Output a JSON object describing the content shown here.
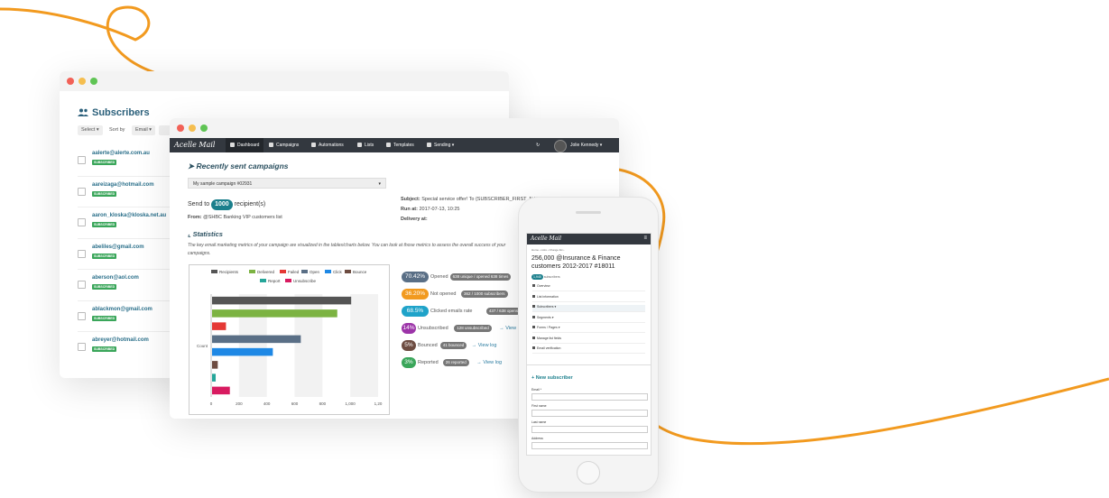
{
  "back_window": {
    "title": "Subscribers",
    "select_label": "Select",
    "sort_by_label": "Sort by",
    "sort_field": "Email",
    "subscribers": [
      {
        "email": "aalerte@alerte.com.au",
        "status": "SUBSCRIBED"
      },
      {
        "email": "aareizaga@hotmail.com",
        "status": "SUBSCRIBED"
      },
      {
        "email": "aaron_kloska@kloska.net.au",
        "status": "SUBSCRIBED"
      },
      {
        "email": "abeliles@gmail.com",
        "status": "SUBSCRIBED"
      },
      {
        "email": "aberson@aol.com",
        "status": "SUBSCRIBED"
      },
      {
        "email": "ablackmon@gmail.com",
        "status": "SUBSCRIBED"
      },
      {
        "email": "abreyer@hotmail.com",
        "status": "SUBSCRIBED"
      }
    ]
  },
  "main_window": {
    "nav": {
      "logo": "Acelle Mail",
      "items": [
        "Dashboard",
        "Campaigns",
        "Automations",
        "Lists",
        "Templates",
        "Sending"
      ],
      "user": "Jolie Kennedy"
    },
    "recent_heading": "Recently sent campaigns",
    "campaign_select": "My sample campaign #02931",
    "send_to_prefix": "Send to",
    "send_to_count": "1000",
    "send_to_suffix": "recipient(s)",
    "from_label": "From:",
    "from_value": "@SHBC Banking VIP customers list",
    "subject_label": "Subject:",
    "subject_value": "Special service offer! To {SUBSCRIBER_FIRST_NAME}",
    "run_at_label": "Run at:",
    "run_at_value": "2017-07-13, 10:25",
    "delivery_label": "Delivery at:",
    "statistics_heading": "Statistics",
    "statistics_desc": "The key email marketing metrics of your campaign are visualized in the tables/charts below. You can look at those metrics to assess the overall success of your",
    "statistics_desc2": "campaigns.",
    "stats": [
      {
        "pct": "70.42%",
        "label": "Opened",
        "pill": "638 unique / opened 638 times",
        "color": "#5a6f86",
        "log": ""
      },
      {
        "pct": "36.20%",
        "label": "Not opened",
        "pill": "362 / 1000 subscribers",
        "color": "#f29a1f",
        "log": "→"
      },
      {
        "pct": "68.5%",
        "label": "Clicked emails rate",
        "pill": "437 / 638 opens",
        "color": "#1fa3c9",
        "log": "→"
      },
      {
        "pct": "14%",
        "label": "Unsubscribed",
        "pill": "128 unsubscribed",
        "color": "#9c34a8",
        "log": "→ View l"
      },
      {
        "pct": "5%",
        "label": "Bounced",
        "pill": "41 bounced",
        "color": "#6d4c41",
        "log": "→ View log"
      },
      {
        "pct": "3%",
        "label": "Reported",
        "pill": "26 reported",
        "color": "#3aa65a",
        "log": "→ View log"
      }
    ]
  },
  "chart_data": {
    "type": "bar",
    "orientation": "horizontal",
    "categories": [
      "Count"
    ],
    "series": [
      {
        "name": "Recipients",
        "values": [
          1000
        ],
        "color": "#555555"
      },
      {
        "name": "Delivered",
        "values": [
          900
        ],
        "color": "#7cb342"
      },
      {
        "name": "Failed",
        "values": [
          100
        ],
        "color": "#e53935"
      },
      {
        "name": "Open",
        "values": [
          638
        ],
        "color": "#5a6f86"
      },
      {
        "name": "Click",
        "values": [
          437
        ],
        "color": "#1e88e5"
      },
      {
        "name": "Bounce",
        "values": [
          41
        ],
        "color": "#6d4c41"
      },
      {
        "name": "Report",
        "values": [
          26
        ],
        "color": "#26a69a"
      },
      {
        "name": "Unsubscribe",
        "values": [
          128
        ],
        "color": "#d81b60"
      }
    ],
    "xlim": [
      0,
      1200
    ],
    "x_ticks": [
      "0",
      "200",
      "400",
      "600",
      "800",
      "1,000",
      "1,20"
    ],
    "ylabel_tick": "Count",
    "legend_position": "top"
  },
  "phone": {
    "logo": "Acelle Mail",
    "breadcrumb": "Home › Lists › Change list ›",
    "title": "256,000 @Insurance & Finance customers 2012-2017 #18011",
    "count_badge": "1,945",
    "count_label": "subscribers",
    "menu": [
      "Overview",
      "List information",
      "Subscribers ▾",
      "Segments ▾",
      "Forms / Pages ▾",
      "Manage list fields",
      "Email verification"
    ],
    "new_subscriber": "+ New subscriber",
    "fields": [
      "Email *",
      "First name",
      "Last name",
      "Address"
    ]
  },
  "colors": {
    "accent": "#f29a1f",
    "nav_bg": "#33383f",
    "link": "#2a6f8a",
    "badge_green": "#3aa65a"
  }
}
